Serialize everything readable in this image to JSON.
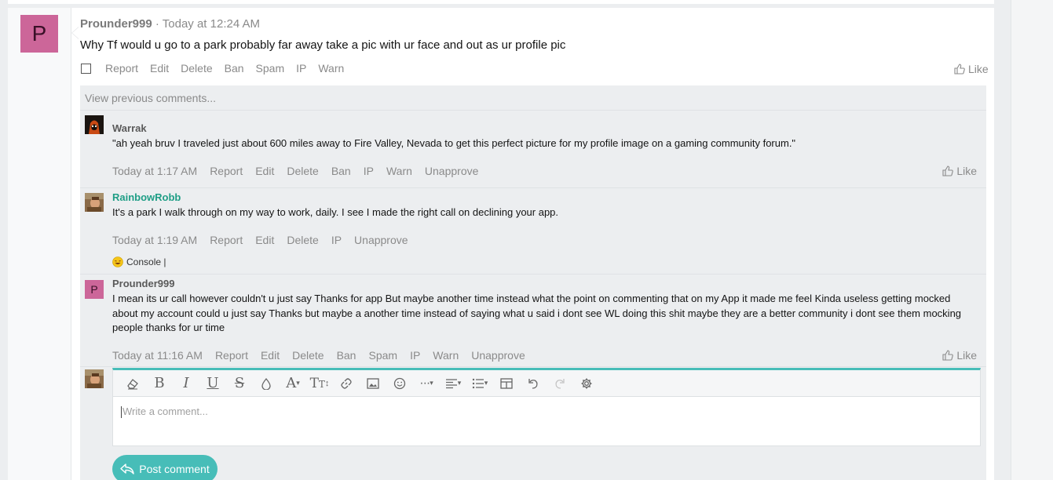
{
  "post": {
    "avatar_letter": "P",
    "author": "Prounder999",
    "separator": " · ",
    "time": "Today at 12:24 AM",
    "body": "Why Tf would u go to a park probably far away take a pic with ur face and out as ur profile pic",
    "actions": [
      "Report",
      "Edit",
      "Delete",
      "Ban",
      "Spam",
      "IP",
      "Warn"
    ],
    "like_label": "Like"
  },
  "comments": {
    "view_previous": "View previous comments...",
    "items": [
      {
        "author": "Warrak",
        "author_color": "#5a5a5a",
        "text": "\"ah yeah bruv I traveled just about 600 miles away to Fire Valley, Nevada to get this perfect picture for my profile image on a gaming community forum.\"",
        "time": "Today at 1:17 AM",
        "actions": [
          "Report",
          "Edit",
          "Delete",
          "Ban",
          "IP",
          "Warn",
          "Unapprove"
        ],
        "like_label": "Like"
      },
      {
        "author": "RainbowRobb",
        "author_color": "#1f9e86",
        "text": "It's a park I walk through on my way to work, daily. I see I made the right call on declining your app.",
        "time": "Today at 1:19 AM",
        "actions": [
          "Report",
          "Edit",
          "Delete",
          "IP",
          "Unapprove"
        ],
        "signature": "Console |"
      },
      {
        "author": "Prounder999",
        "author_color": "#5a5a5a",
        "avatar_letter": "P",
        "text": "I mean its ur call however couldn't u just say Thanks for app But maybe another time instead what the point on commenting that on my App it made me feel Kinda useless getting mocked about my account could u just say Thanks but maybe a another time instead of saying what u said i dont see WL doing this shit maybe they are a better community i dont see them mocking people thanks for ur time",
        "time": "Today at 11:16 AM",
        "actions": [
          "Report",
          "Edit",
          "Delete",
          "Ban",
          "Spam",
          "IP",
          "Warn",
          "Unapprove"
        ],
        "like_label": "Like"
      }
    ]
  },
  "editor": {
    "placeholder": "Write a comment...",
    "toolbar": [
      "eraser-icon",
      "bold-icon",
      "italic-icon",
      "underline-icon",
      "strikethrough-icon",
      "text-color-icon",
      "font-family-icon",
      "font-size-icon",
      "link-icon",
      "image-icon",
      "smilie-icon",
      "more-icon",
      "align-icon",
      "list-icon",
      "table-icon",
      "undo-icon",
      "redo-icon",
      "settings-icon"
    ],
    "submit_label": "Post comment"
  },
  "colors": {
    "accent": "#47bdb8",
    "avatar_p": "#cc6699",
    "rainbowrobb": "#1f9e86"
  }
}
